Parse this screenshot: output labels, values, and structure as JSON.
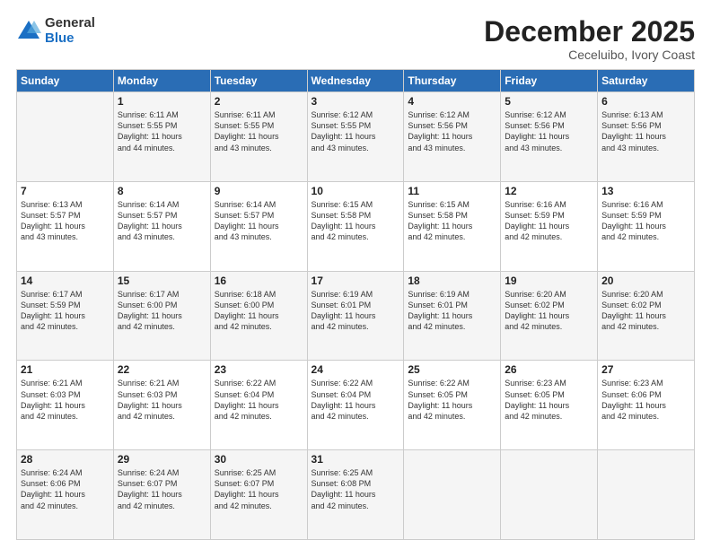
{
  "logo": {
    "general": "General",
    "blue": "Blue"
  },
  "title": "December 2025",
  "location": "Ceceluibo, Ivory Coast",
  "headers": [
    "Sunday",
    "Monday",
    "Tuesday",
    "Wednesday",
    "Thursday",
    "Friday",
    "Saturday"
  ],
  "weeks": [
    [
      {
        "day": "",
        "info": ""
      },
      {
        "day": "1",
        "info": "Sunrise: 6:11 AM\nSunset: 5:55 PM\nDaylight: 11 hours\nand 44 minutes."
      },
      {
        "day": "2",
        "info": "Sunrise: 6:11 AM\nSunset: 5:55 PM\nDaylight: 11 hours\nand 43 minutes."
      },
      {
        "day": "3",
        "info": "Sunrise: 6:12 AM\nSunset: 5:55 PM\nDaylight: 11 hours\nand 43 minutes."
      },
      {
        "day": "4",
        "info": "Sunrise: 6:12 AM\nSunset: 5:56 PM\nDaylight: 11 hours\nand 43 minutes."
      },
      {
        "day": "5",
        "info": "Sunrise: 6:12 AM\nSunset: 5:56 PM\nDaylight: 11 hours\nand 43 minutes."
      },
      {
        "day": "6",
        "info": "Sunrise: 6:13 AM\nSunset: 5:56 PM\nDaylight: 11 hours\nand 43 minutes."
      }
    ],
    [
      {
        "day": "7",
        "info": "Sunrise: 6:13 AM\nSunset: 5:57 PM\nDaylight: 11 hours\nand 43 minutes."
      },
      {
        "day": "8",
        "info": "Sunrise: 6:14 AM\nSunset: 5:57 PM\nDaylight: 11 hours\nand 43 minutes."
      },
      {
        "day": "9",
        "info": "Sunrise: 6:14 AM\nSunset: 5:57 PM\nDaylight: 11 hours\nand 43 minutes."
      },
      {
        "day": "10",
        "info": "Sunrise: 6:15 AM\nSunset: 5:58 PM\nDaylight: 11 hours\nand 42 minutes."
      },
      {
        "day": "11",
        "info": "Sunrise: 6:15 AM\nSunset: 5:58 PM\nDaylight: 11 hours\nand 42 minutes."
      },
      {
        "day": "12",
        "info": "Sunrise: 6:16 AM\nSunset: 5:59 PM\nDaylight: 11 hours\nand 42 minutes."
      },
      {
        "day": "13",
        "info": "Sunrise: 6:16 AM\nSunset: 5:59 PM\nDaylight: 11 hours\nand 42 minutes."
      }
    ],
    [
      {
        "day": "14",
        "info": "Sunrise: 6:17 AM\nSunset: 5:59 PM\nDaylight: 11 hours\nand 42 minutes."
      },
      {
        "day": "15",
        "info": "Sunrise: 6:17 AM\nSunset: 6:00 PM\nDaylight: 11 hours\nand 42 minutes."
      },
      {
        "day": "16",
        "info": "Sunrise: 6:18 AM\nSunset: 6:00 PM\nDaylight: 11 hours\nand 42 minutes."
      },
      {
        "day": "17",
        "info": "Sunrise: 6:19 AM\nSunset: 6:01 PM\nDaylight: 11 hours\nand 42 minutes."
      },
      {
        "day": "18",
        "info": "Sunrise: 6:19 AM\nSunset: 6:01 PM\nDaylight: 11 hours\nand 42 minutes."
      },
      {
        "day": "19",
        "info": "Sunrise: 6:20 AM\nSunset: 6:02 PM\nDaylight: 11 hours\nand 42 minutes."
      },
      {
        "day": "20",
        "info": "Sunrise: 6:20 AM\nSunset: 6:02 PM\nDaylight: 11 hours\nand 42 minutes."
      }
    ],
    [
      {
        "day": "21",
        "info": "Sunrise: 6:21 AM\nSunset: 6:03 PM\nDaylight: 11 hours\nand 42 minutes."
      },
      {
        "day": "22",
        "info": "Sunrise: 6:21 AM\nSunset: 6:03 PM\nDaylight: 11 hours\nand 42 minutes."
      },
      {
        "day": "23",
        "info": "Sunrise: 6:22 AM\nSunset: 6:04 PM\nDaylight: 11 hours\nand 42 minutes."
      },
      {
        "day": "24",
        "info": "Sunrise: 6:22 AM\nSunset: 6:04 PM\nDaylight: 11 hours\nand 42 minutes."
      },
      {
        "day": "25",
        "info": "Sunrise: 6:22 AM\nSunset: 6:05 PM\nDaylight: 11 hours\nand 42 minutes."
      },
      {
        "day": "26",
        "info": "Sunrise: 6:23 AM\nSunset: 6:05 PM\nDaylight: 11 hours\nand 42 minutes."
      },
      {
        "day": "27",
        "info": "Sunrise: 6:23 AM\nSunset: 6:06 PM\nDaylight: 11 hours\nand 42 minutes."
      }
    ],
    [
      {
        "day": "28",
        "info": "Sunrise: 6:24 AM\nSunset: 6:06 PM\nDaylight: 11 hours\nand 42 minutes."
      },
      {
        "day": "29",
        "info": "Sunrise: 6:24 AM\nSunset: 6:07 PM\nDaylight: 11 hours\nand 42 minutes."
      },
      {
        "day": "30",
        "info": "Sunrise: 6:25 AM\nSunset: 6:07 PM\nDaylight: 11 hours\nand 42 minutes."
      },
      {
        "day": "31",
        "info": "Sunrise: 6:25 AM\nSunset: 6:08 PM\nDaylight: 11 hours\nand 42 minutes."
      },
      {
        "day": "",
        "info": ""
      },
      {
        "day": "",
        "info": ""
      },
      {
        "day": "",
        "info": ""
      }
    ]
  ]
}
